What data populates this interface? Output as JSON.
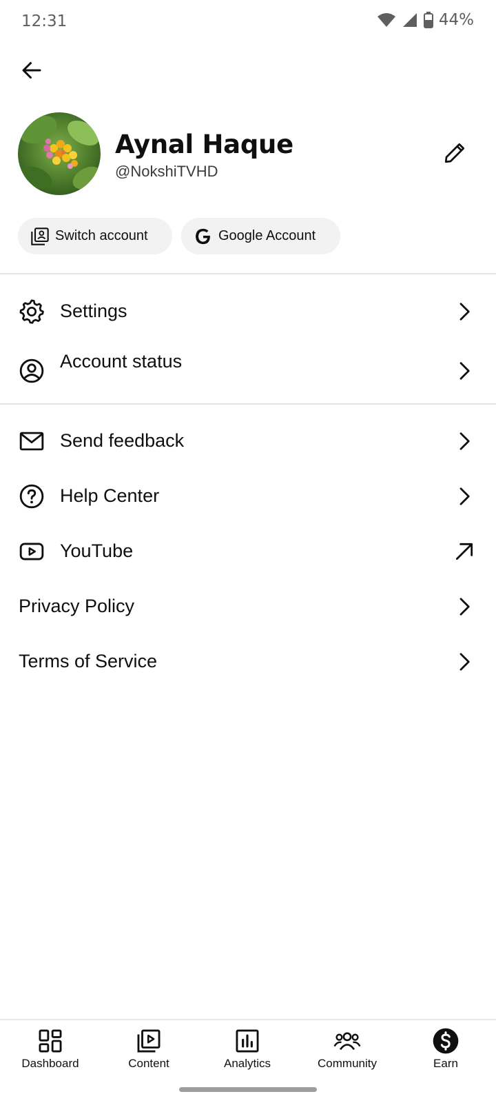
{
  "status_bar": {
    "time": "12:31",
    "battery": "44%",
    "icons": [
      "wifi-icon",
      "signal-icon",
      "battery-icon"
    ]
  },
  "header": {
    "back_icon": "arrow-left-icon"
  },
  "profile": {
    "name": "Aynal Haque",
    "handle": "@NokshiTVHD",
    "edit_icon": "pencil-icon"
  },
  "chips": {
    "switch_account": "Switch account",
    "google_account": "Google Account"
  },
  "menu": {
    "settings": "Settings",
    "account_status": "Account status",
    "send_feedback": "Send feedback",
    "help_center": "Help Center",
    "youtube": "YouTube",
    "privacy_policy": "Privacy Policy",
    "terms_of_service": "Terms of Service"
  },
  "bottom_nav": {
    "dashboard": "Dashboard",
    "content": "Content",
    "analytics": "Analytics",
    "community": "Community",
    "earn": "Earn"
  }
}
